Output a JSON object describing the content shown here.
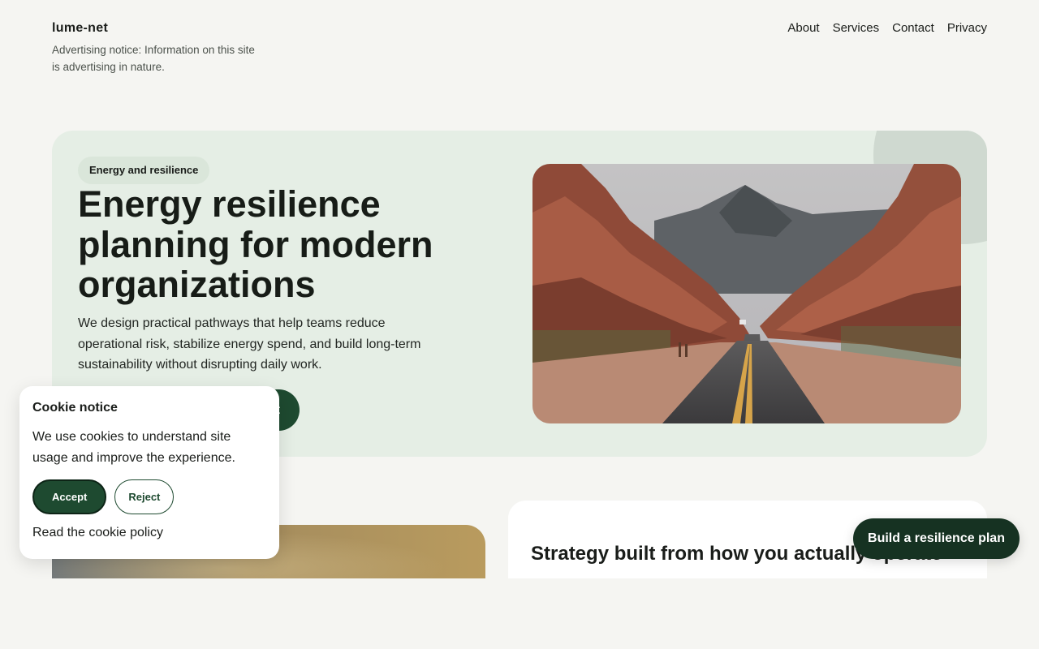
{
  "header": {
    "brand": "lume-net",
    "ad_notice": "Advertising notice: Information on this site is advertising in nature.",
    "nav": [
      "About",
      "Services",
      "Contact",
      "Privacy"
    ]
  },
  "hero": {
    "pill": "Energy and resilience",
    "title": "Energy resilience planning for modern organizations",
    "body": "We design practical pathways that help teams reduce operational risk, stabilize energy spend, and build long-term sustainability without disrupting daily work.",
    "cta_visible_fragment": "t",
    "image": "desert-canyon-road-photo"
  },
  "section": {
    "heading": "Strategy built from how you actually operate",
    "image": "golden-haze-landscape-photo"
  },
  "cookie": {
    "title": "Cookie notice",
    "body": "We use cookies to understand site usage and improve the experience.",
    "accept": "Accept",
    "reject": "Reject",
    "policy_link": "Read the cookie policy"
  },
  "floating_cta": "Build a resilience plan",
  "colors": {
    "page_bg": "#f5f5f2",
    "hero_bg": "#e5eee5",
    "accent_green": "#1e4a30",
    "dark_green": "#163222"
  }
}
